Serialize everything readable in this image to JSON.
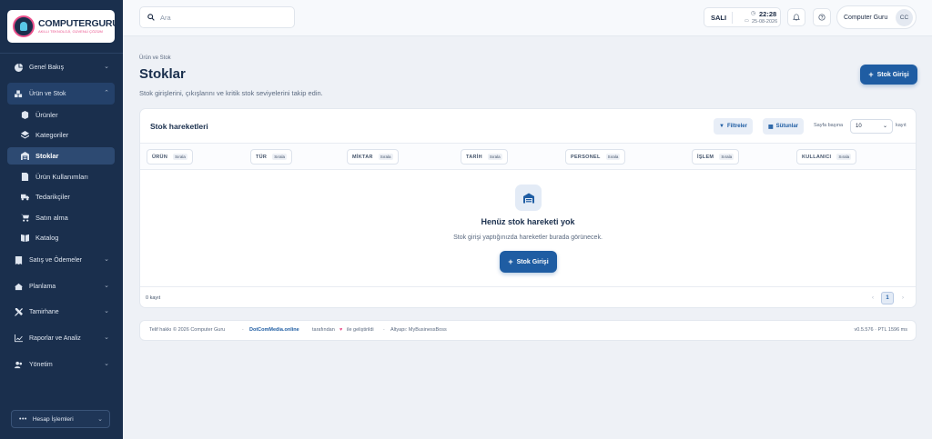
{
  "brand": {
    "name": "COMPUTERGURU",
    "tagline": "AKILLI TEKNOLOJİ, GÜVENLİ ÇÖZÜM"
  },
  "sidebar": {
    "items": [
      {
        "label": "Genel Bakış",
        "icon": "chart-pie-icon"
      },
      {
        "label": "Ürün ve Stok",
        "icon": "boxes-icon",
        "expanded": true,
        "children": [
          {
            "label": "Ürünler",
            "icon": "box-icon"
          },
          {
            "label": "Kategoriler",
            "icon": "layers-icon"
          },
          {
            "label": "Stoklar",
            "icon": "warehouse-icon",
            "active": true
          },
          {
            "label": "Ürün Kullanımları",
            "icon": "document-icon"
          },
          {
            "label": "Tedarikçiler",
            "icon": "truck-icon"
          },
          {
            "label": "Satın alma",
            "icon": "cart-icon"
          },
          {
            "label": "Katalog",
            "icon": "book-icon"
          }
        ]
      },
      {
        "label": "Satış ve Ödemeler",
        "icon": "receipt-icon"
      },
      {
        "label": "Planlama",
        "icon": "calendar-icon"
      },
      {
        "label": "Tamirhane",
        "icon": "tools-icon"
      },
      {
        "label": "Raporlar ve Analiz",
        "icon": "chart-line-icon"
      },
      {
        "label": "Yönetim",
        "icon": "users-icon"
      }
    ],
    "account_label": "Hesap İşlemleri"
  },
  "topbar": {
    "search_placeholder": "Ara",
    "day": "SALI",
    "time": "22:28",
    "date": "25-08-2026",
    "user_name": "Computer Guru",
    "user_initials": "CC"
  },
  "page": {
    "breadcrumb": "Ürün ve Stok",
    "title": "Stoklar",
    "description": "Stok girişlerini, çıkışlarını ve kritik stok seviyelerini takip edin.",
    "primary_action": "Stok Girişi"
  },
  "card": {
    "title": "Stok hareketleri",
    "filters_label": "Filtreler",
    "columns_label": "Sütunlar",
    "per_page_label": "Sayfa başına",
    "per_page_value": "10",
    "per_page_suffix": "kayıt",
    "sort_label": "Sırala",
    "columns": [
      "ÜRÜN",
      "TÜR",
      "MİKTAR",
      "TARİH",
      "PERSONEL",
      "İŞLEM",
      "KULLANICI"
    ],
    "empty_title": "Henüz stok hareketi yok",
    "empty_desc": "Stok girişi yaptığınızda hareketler burada görünecek.",
    "empty_action": "Stok Girişi",
    "record_count": "0 kayıt",
    "current_page": "1"
  },
  "footer": {
    "copyright": "Telif hakkı © 2026 Computer Guru",
    "link": "DotComMedia.online",
    "developed": "tarafından",
    "developed_suffix": "ile geliştirildi",
    "infra": "Altyapı: MyBusinessBoss",
    "version": "v0.5.576 · PTL 1596 ms"
  },
  "colors": {
    "sidebar": "#1a2f4d",
    "accent": "#1f5da3",
    "heart": "#e94f8a"
  }
}
